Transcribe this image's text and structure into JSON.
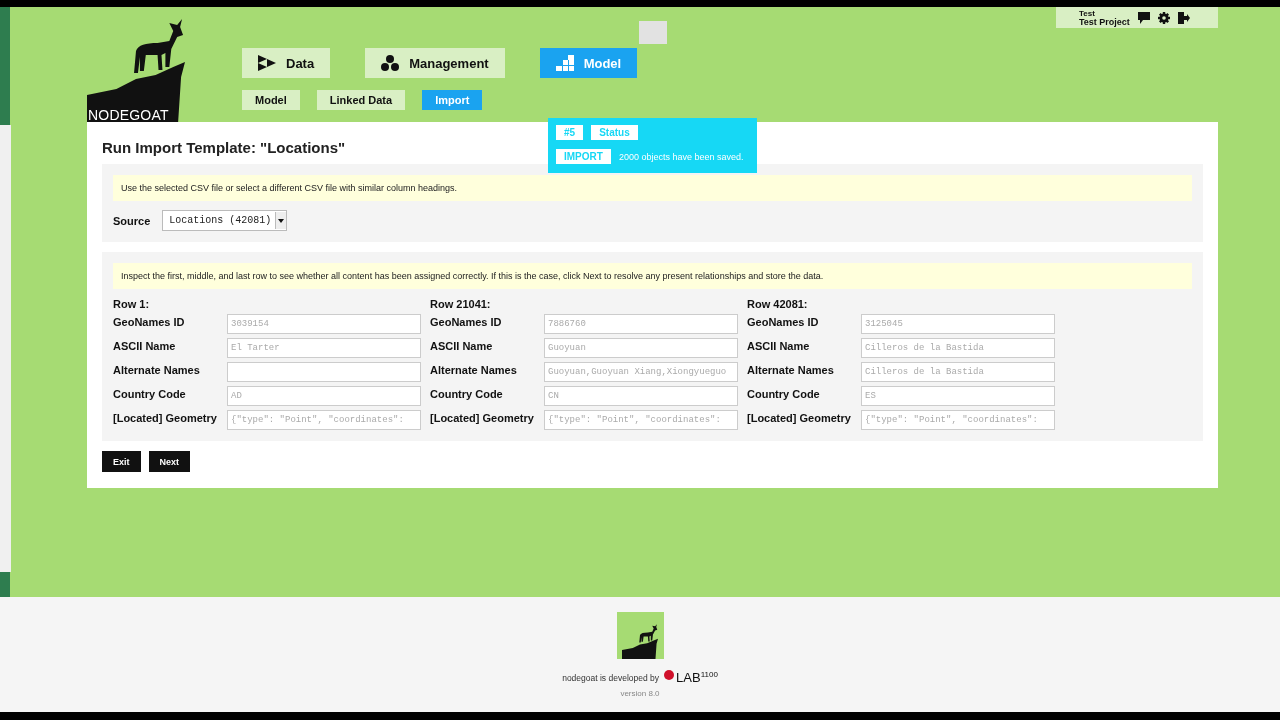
{
  "logo": {
    "text": "NODEGOAT"
  },
  "main_nav": [
    {
      "label": "Data",
      "kind": "data",
      "selected": false
    },
    {
      "label": "Management",
      "kind": "management",
      "selected": false
    },
    {
      "label": "Model",
      "kind": "model",
      "selected": true
    }
  ],
  "sub_nav": [
    {
      "label": "Model",
      "selected": false
    },
    {
      "label": "Linked Data",
      "selected": false
    },
    {
      "label": "Import",
      "selected": true
    }
  ],
  "user": {
    "name": "Test",
    "project": "Test Project"
  },
  "notification": {
    "badges": [
      "#5",
      "Status"
    ],
    "tag": "IMPORT",
    "message": "2000 objects have been saved."
  },
  "page": {
    "title": "Run Import Template: \"Locations\"",
    "source_section": {
      "notice": "Use the selected CSV file or select a different CSV file with similar column headings.",
      "label": "Source",
      "select": "Locations (42081)"
    },
    "preview_section": {
      "notice": "Inspect the first, middle, and last row to see whether all content has been assigned correctly. If this is the case, click Next to resolve any present relationships and store the data.",
      "rows": [
        {
          "heading": "Row 1:",
          "fields": [
            {
              "label": "GeoNames ID",
              "value": "3039154"
            },
            {
              "label": "ASCII Name",
              "value": "El Tarter"
            },
            {
              "label": "Alternate Names"
            },
            {
              "label": "Country Code",
              "value": "AD"
            },
            {
              "label": "[Located] Geometry",
              "value": "{\"type\": \"Point\", \"coordinates\":"
            }
          ]
        },
        {
          "heading": "Row 21041:",
          "fields": [
            {
              "label": "GeoNames ID",
              "value": "7886760"
            },
            {
              "label": "ASCII Name",
              "value": "Guoyuan"
            },
            {
              "label": "Alternate Names",
              "value": "Guoyuan,Guoyuan Xiang,Xiongyueguo"
            },
            {
              "label": "Country Code",
              "value": "CN"
            },
            {
              "label": "[Located] Geometry",
              "value": "{\"type\": \"Point\", \"coordinates\":"
            }
          ]
        },
        {
          "heading": "Row 42081:",
          "fields": [
            {
              "label": "GeoNames ID",
              "value": "3125045"
            },
            {
              "label": "ASCII Name",
              "value": "Cilleros de la Bastida"
            },
            {
              "label": "Alternate Names",
              "value": "Cilleros de la Bastida"
            },
            {
              "label": "Country Code",
              "value": "ES"
            },
            {
              "label": "[Located] Geometry",
              "value": "{\"type\": \"Point\", \"coordinates\":"
            }
          ]
        }
      ]
    },
    "buttons": [
      "Exit",
      "Next"
    ]
  },
  "footer": {
    "developed_by": "nodegoat is developed by",
    "lab": "LAB",
    "lab_superscript": "1100",
    "version": "version 8.0"
  }
}
